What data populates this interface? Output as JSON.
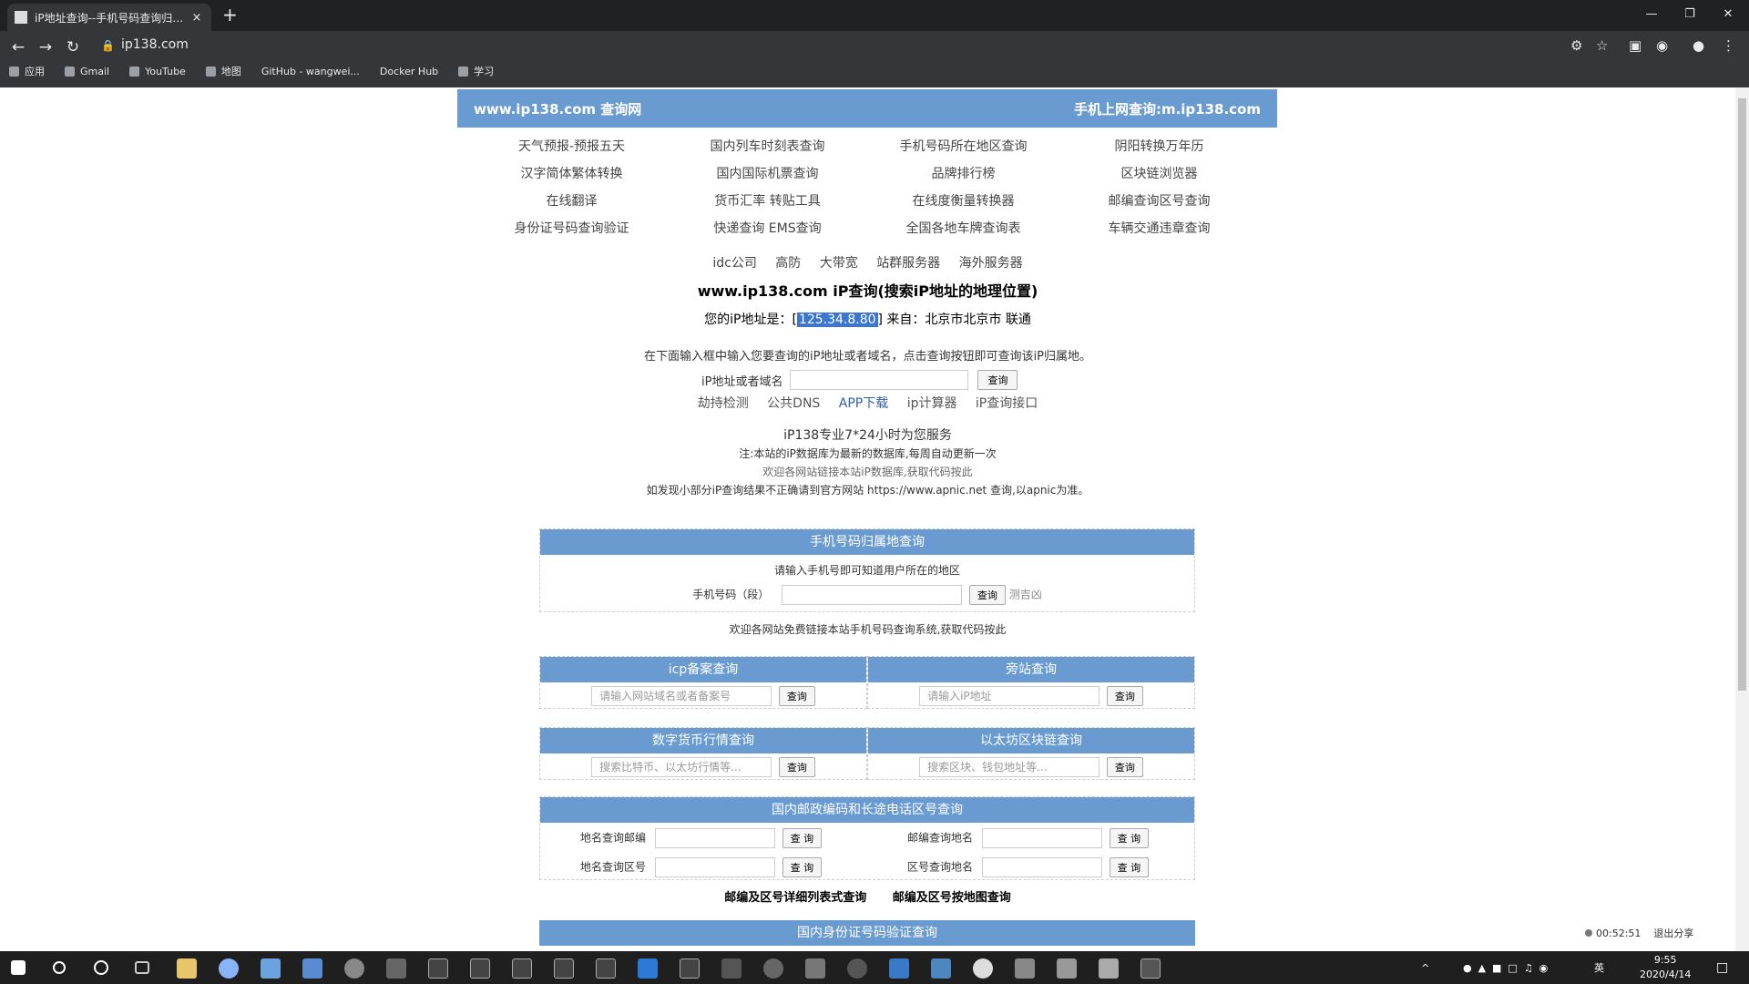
{
  "browser": {
    "tab_title": "iP地址查询--手机号码查询归属地",
    "tab_close": "×",
    "new_tab": "+",
    "address": "ip138.com",
    "bookmarks": [
      "应用",
      "Gmail",
      "YouTube",
      "地图",
      "GitHub - wangwei...",
      "Docker Hub",
      "学习"
    ]
  },
  "header": {
    "left": "www.ip138.com 查询网",
    "right": "手机上网查询:m.ip138.com"
  },
  "links": [
    "天气预报-预报五天",
    "国内列车时刻表查询",
    "手机号码所在地区查询",
    "阴阳转换万年历",
    "汉字简体繁体转换",
    "国内国际机票查询",
    "品牌排行榜",
    "区块链浏览器",
    "在线翻译",
    "货币汇率 转贴工具",
    "在线度衡量转换器",
    "邮编查询区号查询",
    "身份证号码查询验证",
    "快递查询 EMS查询",
    "全国各地车牌查询表",
    "车辆交通违章查询"
  ],
  "quick_links": [
    "idc公司",
    "高防",
    "大带宽",
    "站群服务器",
    "海外服务器"
  ],
  "ip_query": {
    "title": "www.ip138.com iP查询(搜索iP地址的地理位置)",
    "prefix": "您的iP地址是：[",
    "ip": "125.34.8.80",
    "suffix": "] 来自：北京市北京市 联通",
    "desc": "在下面输入框中输入您要查询的iP地址或者域名，点击查询按钮即可查询该iP归属地。",
    "label": "iP地址或者域名",
    "button": "查询"
  },
  "tools": [
    "劫持检测",
    "公共DNS",
    "APP下载",
    "ip计算器",
    "iP查询接口"
  ],
  "notes": {
    "service": "iP138专业7*24小时为您服务",
    "note1": "注:本站的iP数据库为最新的数据库,每周自动更新一次",
    "note2": "欢迎各网站链接本站iP数据库,获取代码按此",
    "note3": "如发现小部分iP查询结果不正确请到官方网站 https://www.apnic.net 查询,以apnic为准。"
  },
  "mobile": {
    "title": "手机号码归属地查询",
    "desc": "请输入手机号即可知道用户所在的地区",
    "label": "手机号码（段）",
    "button": "查询",
    "extra": "测吉凶",
    "footer": "欢迎各网站免费链接本站手机号码查询系统,获取代码按此"
  },
  "icp": {
    "title": "icp备案查询",
    "placeholder": "请输入网站域名或者备案号",
    "button": "查询"
  },
  "side": {
    "title": "旁站查询",
    "placeholder": "请输入iP地址",
    "button": "查询"
  },
  "crypto": {
    "title": "数字货币行情查询",
    "placeholder": "搜索比特币、以太坊行情等...",
    "button": "查询"
  },
  "eth": {
    "title": "以太坊区块链查询",
    "placeholder": "搜索区块、钱包地址等...",
    "button": "查询"
  },
  "postal": {
    "title": "国内邮政编码和长途电话区号查询",
    "rows": [
      {
        "l_label": "地名查询邮编",
        "r_label": "邮编查询地名"
      },
      {
        "l_label": "地名查询区号",
        "r_label": "区号查询地名"
      }
    ],
    "button": "查 询"
  },
  "bold_links": [
    "邮编及区号详细列表式查询",
    "邮编及区号按地图查询"
  ],
  "idcard": {
    "title": "国内身份证号码验证查询"
  },
  "recorder": {
    "time": "00:52:51",
    "stop": "退出分享"
  },
  "clock": {
    "time": "9:55",
    "date": "2020/4/14"
  },
  "tray_lang": "英",
  "colors": {
    "header_blue": "#6a9bd0",
    "chrome_dark": "#35363a",
    "taskbar": "#1f1f1f"
  }
}
